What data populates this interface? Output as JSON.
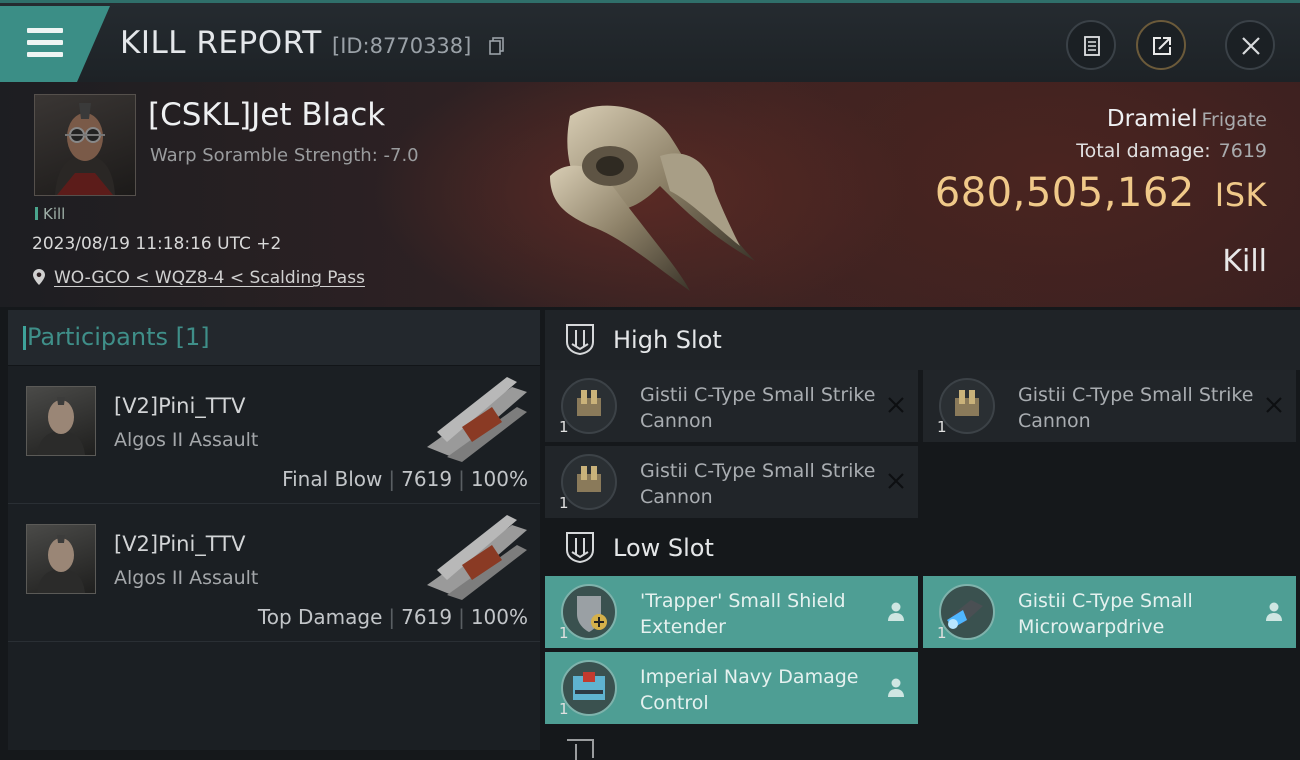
{
  "header": {
    "title": "KILL REPORT",
    "report_id": "[ID:8770338]"
  },
  "victim": {
    "name": "[CSKL]Jet Black",
    "scram": "Warp Soramble Strength: -7.0",
    "tag": "Kill",
    "datetime": "2023/08/19 11:18:16 UTC +2",
    "location": "WO-GCO < WQZ8-4 < Scalding Pass",
    "ship": "Dramiel",
    "ship_class": "Frigate",
    "total_damage_label": "Total damage:",
    "total_damage": "7619",
    "isk_value": "680,505,162",
    "isk_unit": "ISK",
    "result": "Kill"
  },
  "participants": {
    "label": "Participants [1]",
    "rows": [
      {
        "name": "[V2]Pini_TTV",
        "ship": "Algos II Assault",
        "role": "Final Blow",
        "damage": "7619",
        "percent": "100%"
      },
      {
        "name": "[V2]Pini_TTV",
        "ship": "Algos II Assault",
        "role": "Top Damage",
        "damage": "7619",
        "percent": "100%"
      }
    ]
  },
  "fitting": {
    "high_slot_label": "High Slot",
    "low_slot_label": "Low Slot",
    "high_modules": [
      {
        "name": "Gistii C-Type Small Strike Cannon",
        "qty": "1"
      },
      {
        "name": "Gistii C-Type Small Strike Cannon",
        "qty": "1"
      },
      {
        "name": "Gistii C-Type Small Strike Cannon",
        "qty": "1"
      }
    ],
    "low_modules": [
      {
        "name": "'Trapper' Small Shield Extender",
        "qty": "1"
      },
      {
        "name": "Gistii C-Type Small Microwarpdrive",
        "qty": "1"
      },
      {
        "name": "Imperial Navy Damage Control",
        "qty": "1"
      }
    ]
  },
  "colors": {
    "accent": "#3b8e86",
    "isk": "#f0c989",
    "active_module": "#4e9e94"
  }
}
